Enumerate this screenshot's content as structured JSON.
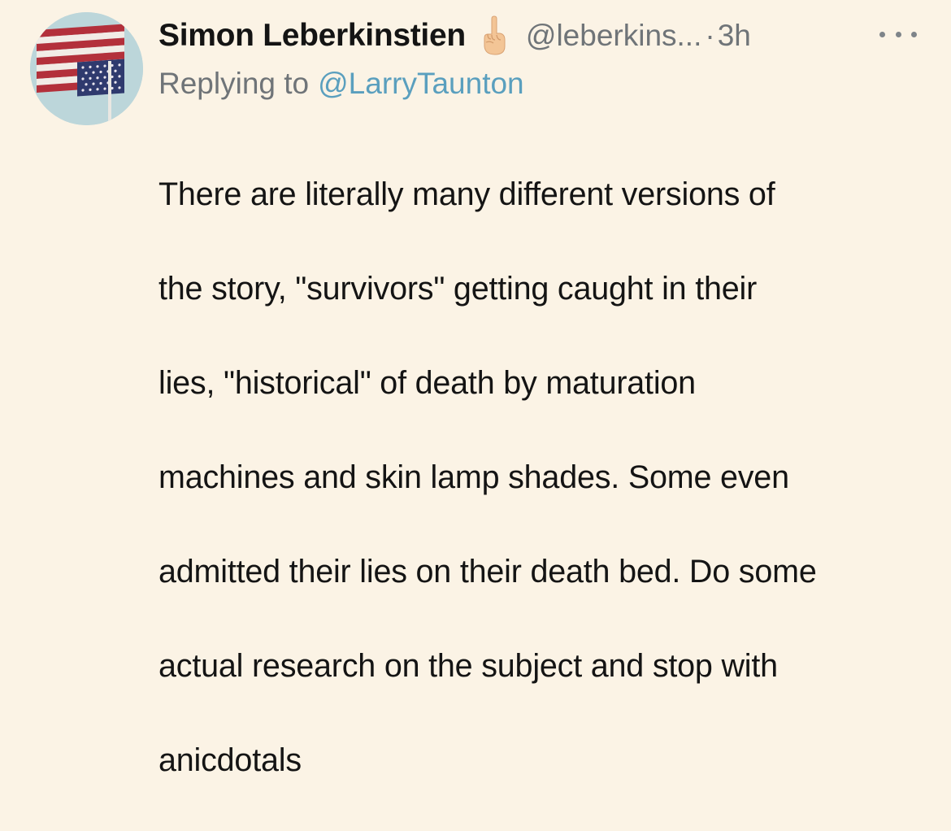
{
  "tweet": {
    "author": {
      "display_name": "Simon Leberkinstien",
      "handle": "@leberkins...",
      "avatar": "upside-down-american-flag",
      "name_emoji": "middle-finger-emoji"
    },
    "separator": "·",
    "time": "3h",
    "more_icon": "more-horizontal-icon",
    "reply": {
      "prefix": "Replying to",
      "handle": "@LarryTaunton"
    },
    "body_lines": [
      "There are literally many different versions of",
      "the story, \"survivors\" getting caught in their",
      "lies, \"historical\" of death by maturation",
      "machines and skin lamp shades. Some even",
      "admitted their lies on their death bed. Do some",
      "actual research on the subject and stop with",
      "anicdotals"
    ]
  },
  "colors": {
    "background": "#fbf3e5",
    "text": "#141414",
    "secondary": "#6f7478",
    "link": "#5a9fbe"
  }
}
